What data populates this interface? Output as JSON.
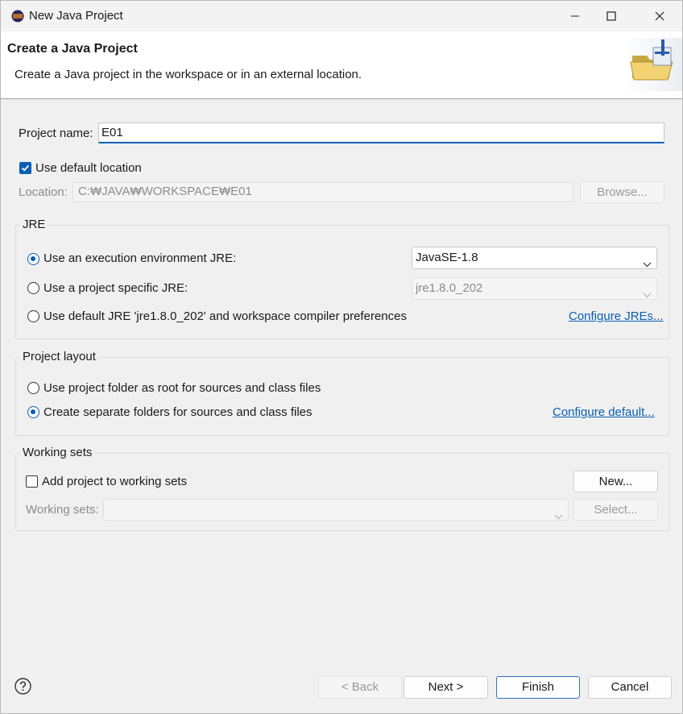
{
  "window": {
    "title": "New Java Project",
    "icon": "eclipse-icon",
    "controls": {
      "minimize": "minimize-icon",
      "maximize": "maximize-icon",
      "close": "close-icon"
    }
  },
  "banner": {
    "title": "Create a Java Project",
    "description": "Create a Java project in the workspace or in an external location.",
    "icon": "java-project-folder-icon"
  },
  "project_name": {
    "label": "Project name:",
    "value": "E01"
  },
  "location": {
    "use_default_label": "Use default location",
    "use_default_checked": true,
    "label": "Location:",
    "value": "C:₩JAVA₩WORKSPACE₩E01",
    "browse_label": "Browse..."
  },
  "jre": {
    "group_title": "JRE",
    "option_execution_env": "Use an execution environment JRE:",
    "option_project_specific": "Use a project specific JRE:",
    "option_default": "Use default JRE 'jre1.8.0_202' and workspace compiler preferences",
    "selected": "execution_env",
    "execution_env_value": "JavaSE-1.8",
    "project_specific_value": "jre1.8.0_202",
    "configure_link": "Configure JREs..."
  },
  "layout": {
    "group_title": "Project layout",
    "option_root": "Use project folder as root for sources and class files",
    "option_separate": "Create separate folders for sources and class files",
    "selected": "separate",
    "configure_link": "Configure default..."
  },
  "working_sets": {
    "group_title": "Working sets",
    "add_label": "Add project to working sets",
    "add_checked": false,
    "new_button": "New...",
    "sets_label": "Working sets:",
    "sets_value": "",
    "select_button": "Select..."
  },
  "footer": {
    "help_icon": "help-icon",
    "back_label": "< Back",
    "next_label": "Next >",
    "finish_label": "Finish",
    "cancel_label": "Cancel"
  }
}
